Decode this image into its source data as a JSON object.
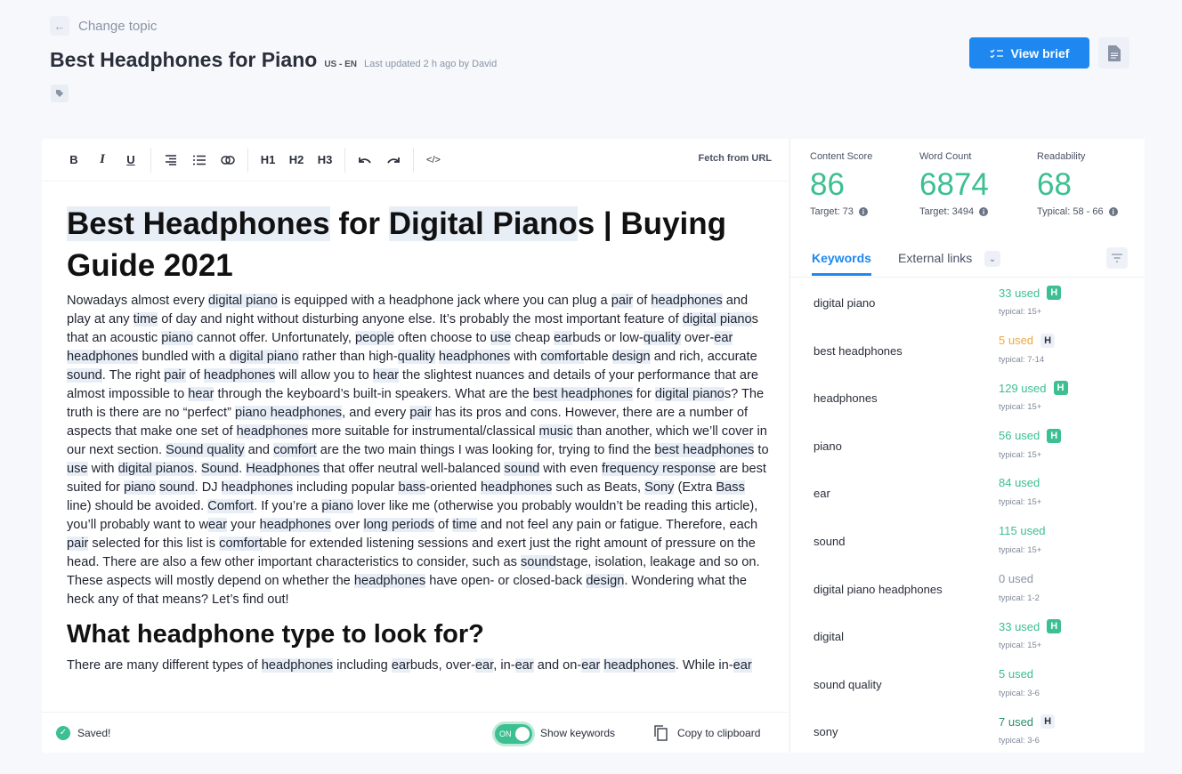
{
  "header": {
    "back_label": "Change topic",
    "title": "Best Headphones for Piano",
    "locale": "US - EN",
    "updated": "Last updated 2 h ago by David",
    "view_brief": "View brief"
  },
  "toolbar": {
    "bold": "B",
    "italic": "I",
    "underline": "U",
    "h1": "H1",
    "h2": "H2",
    "h3": "H3",
    "code": "</>",
    "fetch": "Fetch from URL"
  },
  "article": {
    "heading": [
      "",
      "Best Headphones",
      " for ",
      "Digital Piano",
      "s | Buying Guide 2021"
    ],
    "p1": [
      "Nowadays almost every ",
      "digital piano",
      " is equipped with a headphone jack where you can plug a ",
      "pair",
      " of ",
      "headphones",
      " and play at any ",
      "time",
      " of day and night without disturbing anyone else. It’s probably the most important feature of ",
      "digital piano",
      "s that an acoustic ",
      "piano",
      " cannot offer. Unfortunately, ",
      "people",
      " often choose to ",
      "use",
      " cheap ",
      "ear",
      "buds or low-",
      "quality",
      " over-",
      "ear",
      " ",
      "headphones",
      " bundled with a ",
      "digital piano",
      " rather than high-",
      "quality",
      " ",
      "headphones",
      " with ",
      "comfort",
      "able ",
      "design",
      " and rich, accurate ",
      "sound",
      ". The right ",
      "pair",
      " of ",
      "headphones",
      " will allow you to ",
      "hear",
      " the slightest nuances and details of your performance that are almost impossible to ",
      "hear",
      " through the keyboard’s built-in speakers. What are the ",
      "best headphones",
      " for ",
      "digital piano",
      "s? The truth is there are no “perfect” ",
      "piano headphones",
      ", and every ",
      "pair",
      " has its pros and cons. However, there are a number of aspects that make one set of ",
      "headphones",
      " more suitable for instrumental/classical ",
      "music",
      " than another, which we’ll cover in our next section. ",
      "Sound quality",
      " and ",
      "comfort",
      " are the two main things I was looking for, trying to find the ",
      "best headphones",
      " to ",
      "use",
      " with ",
      "digital pianos",
      ". ",
      "Sound",
      ". ",
      "Headphones",
      " that offer neutral well-balanced ",
      "sound",
      " with even ",
      "frequency response",
      " are best suited for ",
      "piano",
      " ",
      "sound",
      ". DJ ",
      "headphones",
      " including popular ",
      "bass",
      "-oriented ",
      "headphones",
      " such as Beats, ",
      "Sony",
      " (Extra ",
      "Bass",
      " line) should be avoided. ",
      "Comfort",
      ". If you’re a ",
      "piano",
      " lover like me (otherwise you probably wouldn’t be reading this article), you’ll probably want to w",
      "ear",
      " your ",
      "headphones",
      " over ",
      "long periods",
      " of ",
      "time",
      " and not feel any pain or fatigue. Therefore, each ",
      "pair",
      " selected for this list is ",
      "comfort",
      "able for extended listening sessions and exert just the right amount of pressure on the head. There are also a few other important characteristics to consider, such as ",
      "sound",
      "stage, isolation, leakage and so on. These aspects will mostly depend on whether the ",
      "headphones",
      " have open- or closed-back ",
      "design",
      ". Wondering what the heck any of that means? Let’s find out!"
    ],
    "subheading": "What headphone type to look for?",
    "p2": [
      "There are many different types of ",
      "headphones",
      " including ",
      "ear",
      "buds, over-",
      "ear",
      ", in-",
      "ear",
      " and on-",
      "ear",
      " ",
      "headphones",
      ". While in-",
      "ear"
    ]
  },
  "footer": {
    "saved": "Saved!",
    "toggle": "ON",
    "show_keywords": "Show keywords",
    "copy": "Copy to clipboard",
    "show_keywords_on": true
  },
  "metrics": [
    {
      "label": "Content Score",
      "value": "86",
      "sub": "Target: 73"
    },
    {
      "label": "Word Count",
      "value": "6874",
      "sub": "Target: 3494"
    },
    {
      "label": "Readability",
      "value": "68",
      "sub": "Typical: 58 - 66"
    }
  ],
  "tabs": {
    "keywords": "Keywords",
    "external": "External links"
  },
  "colors": {
    "good": "#3cbf91",
    "warn": "#f0a73c",
    "none": "#8a94a6",
    "dark": "#2a8f6a",
    "accent": "#1e88f0"
  },
  "keywords": [
    {
      "name": "digital piano",
      "used": "33 used",
      "status": "good",
      "typical": "typical: 15+",
      "badge": "green"
    },
    {
      "name": "best headphones",
      "used": "5 used",
      "status": "warn",
      "typical": "typical: 7-14",
      "badge": "gray"
    },
    {
      "name": "headphones",
      "used": "129 used",
      "status": "good",
      "typical": "typical: 15+",
      "badge": "green"
    },
    {
      "name": "piano",
      "used": "56 used",
      "status": "good",
      "typical": "typical: 15+",
      "badge": "green"
    },
    {
      "name": "ear",
      "used": "84 used",
      "status": "good",
      "typical": "typical: 15+",
      "badge": ""
    },
    {
      "name": "sound",
      "used": "115 used",
      "status": "good",
      "typical": "typical: 15+",
      "badge": ""
    },
    {
      "name": "digital piano headphones",
      "used": "0 used",
      "status": "none",
      "typical": "typical: 1-2",
      "badge": ""
    },
    {
      "name": "digital",
      "used": "33 used",
      "status": "good",
      "typical": "typical: 15+",
      "badge": "green"
    },
    {
      "name": "sound quality",
      "used": "5 used",
      "status": "good",
      "typical": "typical: 3-6",
      "badge": ""
    },
    {
      "name": "sony",
      "used": "7 used",
      "status": "dark",
      "typical": "typical: 3-6",
      "badge": "gray"
    }
  ],
  "badge_label": "H"
}
